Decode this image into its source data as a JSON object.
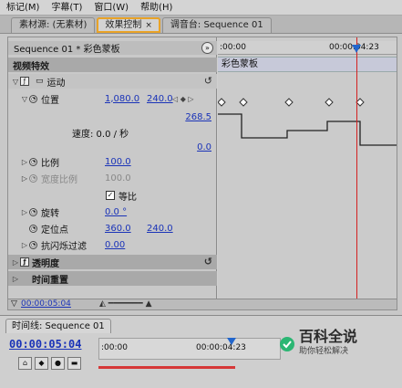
{
  "menubar": {
    "items": [
      "标记(M)",
      "字幕(T)",
      "窗口(W)",
      "帮助(H)"
    ]
  },
  "tabs": [
    {
      "label": "素材源: (无素材)",
      "active": false
    },
    {
      "label": "效果控制",
      "active": true
    },
    {
      "label": "调音台: Sequence 01",
      "active": false
    }
  ],
  "effects": {
    "header": "Sequence 01 * 彩色蒙板",
    "video_effects_label": "视频特效",
    "motion_label": "运动",
    "position_label": "位置",
    "position_x": "1,080.0",
    "position_y": "240.0",
    "graph_top": "268.5",
    "speed_label": "速度: 0.0 / 秒",
    "graph_bottom": "0.0",
    "scale_label": "比例",
    "scale_value": "100.0",
    "scale_width_label": "宽度比例",
    "scale_width_value": "100.0",
    "uniform_label": "等比",
    "rotation_label": "旋转",
    "rotation_value": "0.0 °",
    "anchor_label": "定位点",
    "anchor_x": "360.0",
    "anchor_y": "240.0",
    "flicker_label": "抗闪烁过滤",
    "flicker_value": "0.00",
    "opacity_label": "透明度",
    "remap_label": "时间重置",
    "footer_time": "00:00:05:04"
  },
  "timeline_ruler": {
    "start": ":00:00",
    "end": "00:00:04:23",
    "clip_label": "彩色蒙板"
  },
  "timeline_panel": {
    "tab_label": "时间线: Sequence 01",
    "current_time": "00:00:05:04",
    "ruler_start": ":00:00",
    "ruler_mid": "00:00:04:23"
  },
  "watermark": {
    "main": "百科全说",
    "sub": "助你轻松解决"
  },
  "colors": {
    "accent": "#e9a327",
    "link": "#1a33b8",
    "playhead": "#d42020"
  }
}
